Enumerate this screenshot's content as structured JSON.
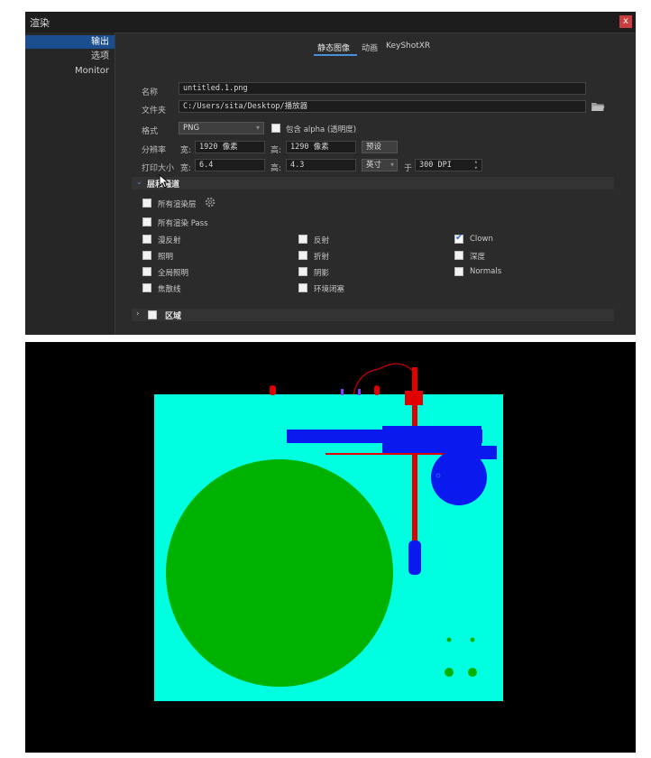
{
  "dialog": {
    "title": "渲染",
    "close_label": "x",
    "sidebar": [
      "输出",
      "选项",
      "Monitor"
    ],
    "tabs": [
      "静态图像",
      "动画",
      "KeyShotXR"
    ],
    "name_label": "名称",
    "name_value": "untitled.1.png",
    "folder_label": "文件夹",
    "folder_value": "C:/Users/sita/Desktop/播放器",
    "format_label": "格式",
    "format_value": "PNG",
    "alpha_label": "包含 alpha (透明度)",
    "resolution_label": "分辨率",
    "width_label": "宽:",
    "width_value": "1920 像素",
    "height_label": "高:",
    "height_value": "1290 像素",
    "preset_label": "预设",
    "print_label": "打印大小",
    "print_width_value": "6.4",
    "print_height_value": "4.3",
    "unit_value": "英寸",
    "at_label": "于",
    "dpi_value": "300 DPI",
    "layers_section": "层和通道",
    "all_layers_label": "所有渲染层",
    "all_pass_label": "所有渲染 Pass",
    "passes": [
      {
        "label": "漫反射",
        "checked": false
      },
      {
        "label": "反射",
        "checked": false
      },
      {
        "label": "Clown",
        "checked": true
      },
      {
        "label": "照明",
        "checked": false
      },
      {
        "label": "折射",
        "checked": false
      },
      {
        "label": "深度",
        "checked": false
      },
      {
        "label": "全局照明",
        "checked": false
      },
      {
        "label": "阴影",
        "checked": false
      },
      {
        "label": "Normals",
        "checked": false
      },
      {
        "label": "焦散线",
        "checked": false
      },
      {
        "label": "环境闭塞",
        "checked": false
      }
    ],
    "region_section": "区域"
  },
  "colors": {
    "accent": "#1a4e8c",
    "clown_background": "#00ffe0",
    "platter": "#00b200",
    "tonearm": "#e00000",
    "motor": "#0000ee",
    "viewport_bg": "#000000"
  },
  "icons": [
    "close-icon",
    "folder-icon",
    "dropdown-arrow-icon",
    "gear-icon",
    "chevron-down-icon",
    "chevron-right-icon",
    "spinner-icon",
    "cursor-icon"
  ]
}
